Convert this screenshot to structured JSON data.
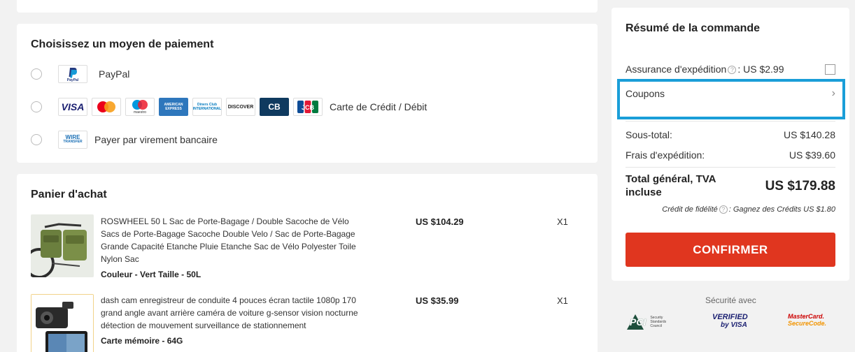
{
  "payment": {
    "title": "Choisissez un moyen de paiement",
    "paypal": {
      "logo_text": "PayPal",
      "label": "PayPal"
    },
    "card": {
      "label": "Carte de Crédit / Débit",
      "logos": {
        "visa": "VISA",
        "amex": "AMERICAN EXPRESS",
        "diners": "Diners Club INTERNATIONAL",
        "discover": "DISCOVER",
        "cb": "CB",
        "jcb": "JCB",
        "maestro": "maestro"
      }
    },
    "wire": {
      "logo_line1": "WIRE",
      "logo_line2": "TRANSFER",
      "label": "Payer par virement bancaire"
    }
  },
  "cart": {
    "title": "Panier d'achat",
    "items": [
      {
        "title": "ROSWHEEL 50 L Sac de Porte-Bagage / Double Sacoche de Vélo Sacs de Porte-Bagage Sacoche Double Velo / Sac de Porte-Bagage Grande Capacité Etanche Pluie Etanche Sac de Vélo Polyester Toile Nylon Sac",
        "variant": "Couleur - Vert  Taille - 50L",
        "price": "US $104.29",
        "qty": "X1"
      },
      {
        "title": "dash cam enregistreur de conduite 4 pouces écran tactile 1080p 170 grand angle avant arrière caméra de voiture g-sensor vision nocturne détection de mouvement surveillance de stationnement",
        "variant": "Carte mémoire - 64G",
        "price": "US $35.99",
        "qty": "X1"
      }
    ]
  },
  "summary": {
    "title": "Résumé de la commande",
    "insurance_label": "Assurance d'expédition",
    "insurance_value": ": US $2.99",
    "coupons_label": "Coupons",
    "subtotal_label": "Sous-total:",
    "subtotal_value": "US $140.28",
    "shipping_label": "Frais d'expédition:",
    "shipping_value": "US $39.60",
    "total_label": "Total général, TVA incluse",
    "total_value": "US $179.88",
    "loyalty_label": "Crédit de fidélité",
    "loyalty_value": ": Gagnez des Crédits US $1.80",
    "confirm_label": "CONFIRMER"
  },
  "security": {
    "title": "Sécurité avec",
    "pci_main": "PCI",
    "pci_sub": "Security Standards Council",
    "visa_line1": "VERIFIED",
    "visa_line2": "by VISA",
    "mc_line1": "MasterCard.",
    "mc_line2": "SecureCode."
  },
  "colors": {
    "accent": "#e0361f",
    "highlight": "#1a9ed8"
  }
}
